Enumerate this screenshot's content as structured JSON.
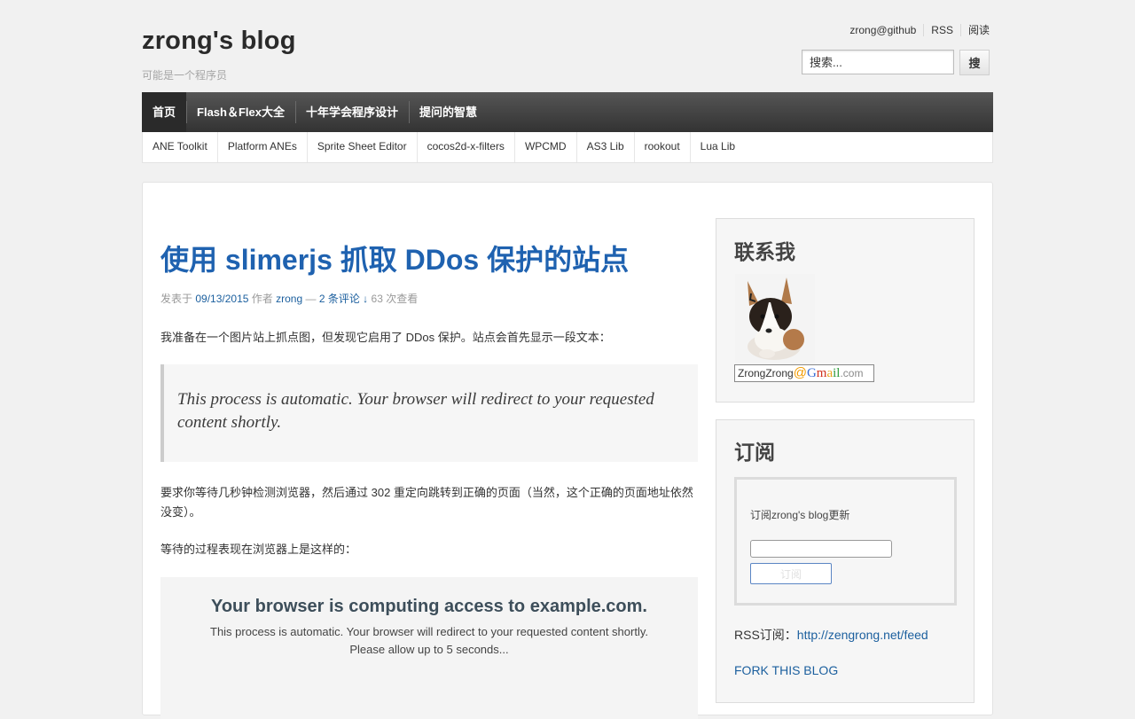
{
  "site": {
    "title": "zrong's blog",
    "description": "可能是一个程序员"
  },
  "toplinks": [
    "zrong@github",
    "RSS",
    "阅读"
  ],
  "search": {
    "placeholder": "搜索...",
    "button_label": "搜"
  },
  "main_nav": [
    "首页",
    "Flash＆Flex大全",
    "十年学会程序设计",
    "提问的智慧"
  ],
  "sub_nav": [
    "ANE Toolkit",
    "Platform ANEs",
    "Sprite Sheet Editor",
    "cocos2d-x-filters",
    "WPCMD",
    "AS3 Lib",
    "rookout",
    "Lua Lib"
  ],
  "post": {
    "title": "使用 slimerjs 抓取 DDos 保护的站点",
    "meta": {
      "posted_on": "发表于",
      "date": "09/13/2015",
      "author_prefix": "作者",
      "author": "zrong",
      "separator": "—",
      "comments": "2 条评论 ↓",
      "views": "63 次查看"
    },
    "paragraph1": "我准备在一个图片站上抓点图，但发现它启用了 DDos 保护。站点会首先显示一段文本：",
    "quote": "This process is automatic. Your browser will redirect to your requested content shortly.",
    "paragraph2": "要求你等待几秒钟检测浏览器，然后通过 302 重定向跳转到正确的页面（当然，这个正确的页面地址依然没变）。",
    "paragraph3": "等待的过程表现在浏览器上是这样的：",
    "screenshot": {
      "headline": "Your browser is computing access to example.com.",
      "line1": "This process is automatic. Your browser will redirect to your requested content shortly.",
      "line2": "Please allow up to 5 seconds..."
    }
  },
  "sidebar": {
    "contact": {
      "title": "联系我",
      "email_name": "ZrongZrong",
      "email_at": "@",
      "email_domain_g": "G",
      "email_domain_m": "m",
      "email_domain_a": "a",
      "email_domain_il": "il",
      "email_tld": ".com"
    },
    "subscribe": {
      "title": "订阅",
      "label": "订阅zrong's blog更新",
      "button_label": "订阅",
      "rss_prefix": "RSS订阅：",
      "rss_url": "http://zengrong.net/feed",
      "fork": "FORK THIS BLOG"
    }
  },
  "colors": {
    "link": "#1b5f9e",
    "post_title": "#1f62b0",
    "nav_bg": "#444444"
  }
}
